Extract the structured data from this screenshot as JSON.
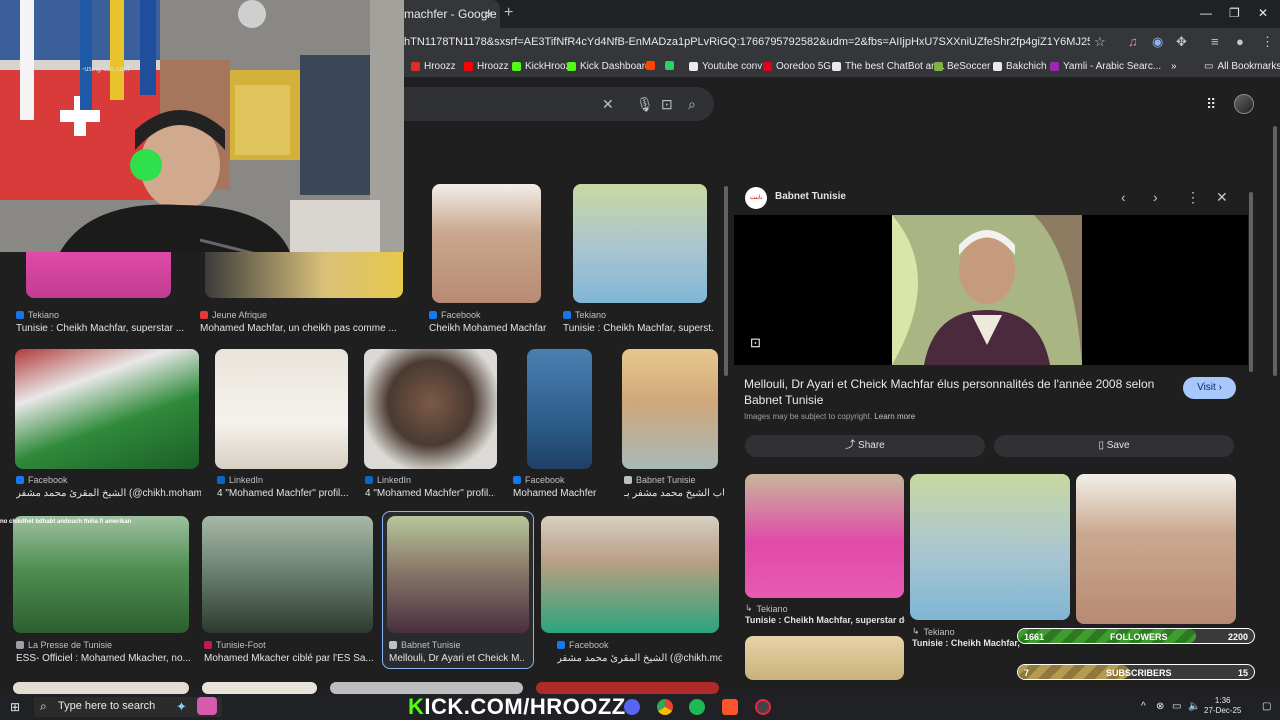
{
  "browser": {
    "tab_title": "machfer - Google Se",
    "url": "hTN1178TN1178&sxsrf=AE3TifNfR4cYd4NfB-EnMADza1pPLvRiGQ:1766795792582&udm=2&fbs=AIIjpHxU7SXXniUZfeShr2fp4giZ1Y6MJ25_tmWITc7uy4KleoJTKjrFjV...",
    "bookmarks": [
      {
        "label": "Hroozz",
        "color": "#d93025"
      },
      {
        "label": "Hroozz",
        "color": "#ff0000"
      },
      {
        "label": "KickHroozz",
        "color": "#53fc18"
      },
      {
        "label": "Kick Dashboard",
        "color": "#53fc18"
      },
      {
        "label": "",
        "color": "#ff4500"
      },
      {
        "label": "",
        "color": "#25d366"
      },
      {
        "label": "Youtube conv",
        "color": "#e8eaed"
      },
      {
        "label": "Ooredoo 5G",
        "color": "#e2001a"
      },
      {
        "label": "The best ChatBot an...",
        "color": "#e8eaed"
      },
      {
        "label": "BeSoccer",
        "color": "#7cb342"
      },
      {
        "label": "Bakchich",
        "color": "#e8eaed"
      },
      {
        "label": "Yamli - Arabic Searc...",
        "color": "#9c27b0"
      }
    ],
    "all_bookmarks": "All Bookmarks"
  },
  "results": [
    {
      "source": "Tekiano",
      "caption": "Tunisie : Cheikh Machfar, superstar ...",
      "color": "#1a73e8"
    },
    {
      "source": "Jeune Afrique",
      "caption": "Mohamed Machfar, un cheikh pas comme ...",
      "color": "#e53935"
    },
    {
      "source": "Facebook",
      "caption": "Cheikh Mohamed Machfar",
      "color": "#1877f2"
    },
    {
      "source": "Tekiano",
      "caption": "Tunisie : Cheikh Machfar, superst...",
      "color": "#1a73e8"
    },
    {
      "source": "Facebook",
      "caption": "الشيخ المقرئ محمد مشفر (@chikh.mohamed...",
      "color": "#1877f2"
    },
    {
      "source": "LinkedIn",
      "caption": "4 \"Mohamed Machfer\" profil...",
      "color": "#0a66c2"
    },
    {
      "source": "LinkedIn",
      "caption": "4 \"Mohamed Machfer\" profil...",
      "color": "#0a66c2"
    },
    {
      "source": "Facebook",
      "caption": "Mohamed Machfer",
      "color": "#1877f2"
    },
    {
      "source": "Babnet Tunisie",
      "caption": "خطاب الشيخ محمد مشفر بـ...",
      "color": "#bdc1c6"
    },
    {
      "source": "La Presse de Tunisie",
      "caption": "ESS- Officiel : Mohamed Mkacher, no...",
      "color": "#9aa0a6"
    },
    {
      "source": "Tunisie-Foot",
      "caption": "Mohamed Mkacher ciblé par l'ES Sa...",
      "color": "#c2185b"
    },
    {
      "source": "Babnet Tunisie",
      "caption": "Mellouli, Dr Ayari et Cheick M...",
      "color": "#bdc1c6"
    },
    {
      "source": "Facebook",
      "caption": "الشيخ المقرئ محمد مشفر (@chikh.mohamed...",
      "color": "#1877f2"
    }
  ],
  "chat_overlay_text": "no chikdhet bdhabt andouch thiña fi amerikan",
  "webcam_watermark": "-using obs cam",
  "preview": {
    "site": "Babnet Tunisie",
    "heading": "Mellouli, Dr Ayari et Cheick Machfar élus personnalités de l'année 2008 selon Babnet Tunisie",
    "copyright_note": "Images may be subject to copyright.",
    "learn_more": "Learn more",
    "visit_label": "Visit",
    "share_label": "Share",
    "save_label": "Save",
    "related": [
      {
        "source": "Tekiano",
        "caption": "Tunisie : Cheikh Machfar, superstar de..."
      },
      {
        "source": "Tekiano",
        "caption": "Tunisie : Cheikh Machfar, su..."
      }
    ]
  },
  "stream_overlay": {
    "followers_count": "1661",
    "followers_label": "FOLLOWERS",
    "followers_goal": "2200",
    "followers_progress": 0.755,
    "subscribers_count": "7",
    "subscribers_label": "SUBSCRIBERS",
    "subscribers_goal": "15",
    "subscribers_progress": 0.47
  },
  "taskbar": {
    "search_placeholder": "Type here to search",
    "kick_banner": "KICK.COM/HROOZZ",
    "time": "1:36",
    "date": "27-Dec-25"
  }
}
